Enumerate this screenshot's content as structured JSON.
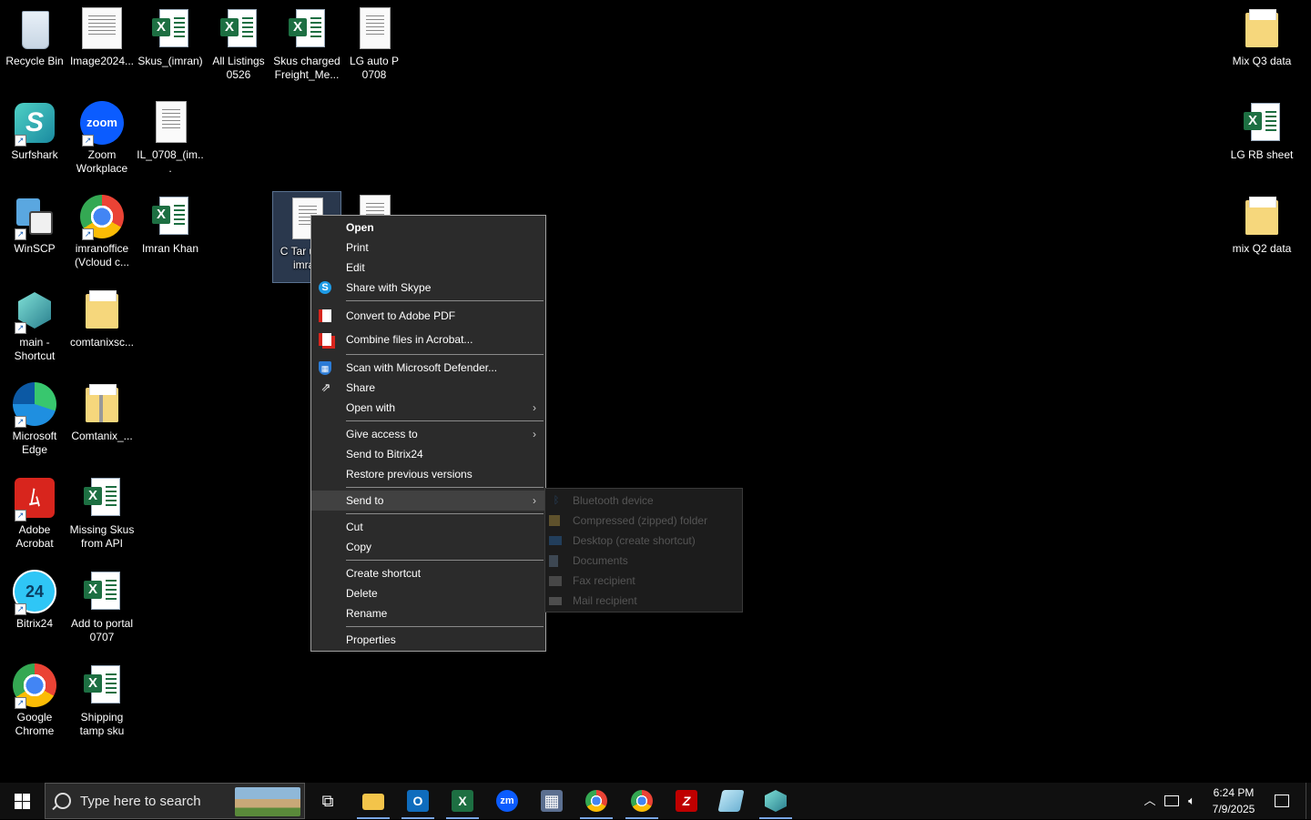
{
  "desktop": {
    "left_icons": [
      {
        "label": "Recycle Bin",
        "icon": "recycle-bin-icon"
      },
      {
        "label": "Image2024...",
        "icon": "image-document-icon"
      },
      {
        "label": "Skus_(imran)",
        "icon": "excel-file-icon"
      },
      {
        "label": "All Listings 0526",
        "icon": "excel-file-icon"
      },
      {
        "label": "Skus charged Freight_Me...",
        "icon": "excel-file-icon"
      },
      {
        "label": "LG auto P 0708",
        "icon": "text-file-icon"
      },
      {
        "label": "Surfshark",
        "icon": "surfshark-icon"
      },
      {
        "label": "Zoom Workplace",
        "icon": "zoom-icon"
      },
      {
        "label": "IL_0708_(im...",
        "icon": "text-file-icon"
      },
      {
        "label": "WinSCP",
        "icon": "winscp-icon"
      },
      {
        "label": "imranoffice (Vcloud c...",
        "icon": "chrome-profile-icon"
      },
      {
        "label": "Imran Khan",
        "icon": "excel-file-icon"
      },
      {
        "label": "C Tar upda imran",
        "icon": "text-file-icon"
      },
      {
        "label": "main - Shortcut",
        "icon": "app-shortcut-icon"
      },
      {
        "label": "comtanixsc...",
        "icon": "folder-icon"
      },
      {
        "label": "Microsoft Edge",
        "icon": "edge-icon"
      },
      {
        "label": "Comtanix_...",
        "icon": "zip-folder-icon"
      },
      {
        "label": "Adobe Acrobat",
        "icon": "acrobat-icon"
      },
      {
        "label": "Missing Skus from API",
        "icon": "excel-file-icon"
      },
      {
        "label": "Bitrix24",
        "icon": "bitrix24-icon"
      },
      {
        "label": "Add to portal 0707",
        "icon": "excel-file-icon"
      },
      {
        "label": "Google Chrome",
        "icon": "chrome-icon"
      },
      {
        "label": "Shipping tamp sku",
        "icon": "excel-file-icon"
      }
    ],
    "right_icons": [
      {
        "label": "Mix Q3 data",
        "icon": "folder-icon"
      },
      {
        "label": "LG RB sheet",
        "icon": "excel-file-icon"
      },
      {
        "label": "mix Q2 data",
        "icon": "folder-icon"
      }
    ]
  },
  "context_menu": {
    "items": [
      {
        "label": "Open"
      },
      {
        "label": "Print"
      },
      {
        "label": "Edit"
      },
      {
        "label": "Share with Skype",
        "icon": "skype-icon"
      },
      {
        "label": "Convert to Adobe PDF",
        "icon": "acrobat-convert-icon"
      },
      {
        "label": "Combine files in Acrobat...",
        "icon": "acrobat-combine-icon"
      },
      {
        "label": "Scan with Microsoft Defender...",
        "icon": "defender-shield-icon"
      },
      {
        "label": "Share",
        "icon": "share-icon"
      },
      {
        "label": "Open with"
      },
      {
        "label": "Give access to"
      },
      {
        "label": "Send to Bitrix24"
      },
      {
        "label": "Restore previous versions"
      },
      {
        "label": "Send to"
      },
      {
        "label": "Cut"
      },
      {
        "label": "Copy"
      },
      {
        "label": "Create shortcut"
      },
      {
        "label": "Delete"
      },
      {
        "label": "Rename"
      },
      {
        "label": "Properties"
      }
    ],
    "submenu_arrow": "›"
  },
  "send_to_submenu": {
    "items": [
      {
        "label": "Bluetooth device",
        "icon": "bluetooth-icon"
      },
      {
        "label": "Compressed (zipped) folder",
        "icon": "zip-folder-icon"
      },
      {
        "label": "Desktop (create shortcut)",
        "icon": "desktop-icon"
      },
      {
        "label": "Documents",
        "icon": "documents-icon"
      },
      {
        "label": "Fax recipient",
        "icon": "fax-icon"
      },
      {
        "label": "Mail recipient",
        "icon": "mail-icon"
      }
    ]
  },
  "taskbar": {
    "search_placeholder": "Type here to search",
    "apps": [
      {
        "name": "task-view",
        "glyph": "⧉"
      },
      {
        "name": "file-explorer",
        "glyph": "▬"
      },
      {
        "name": "outlook",
        "glyph": "O"
      },
      {
        "name": "excel",
        "glyph": "X"
      },
      {
        "name": "zoom",
        "glyph": "zm"
      },
      {
        "name": "calculator",
        "glyph": "▦"
      },
      {
        "name": "chrome",
        "glyph": "◉"
      },
      {
        "name": "chrome-profile",
        "glyph": "◉"
      },
      {
        "name": "filezilla",
        "glyph": "Z"
      },
      {
        "name": "notepad",
        "glyph": "▱"
      },
      {
        "name": "main-app",
        "glyph": "◆"
      }
    ],
    "clock": {
      "time": "6:24 PM",
      "date": "7/9/2025"
    },
    "colors": {
      "excel_green": "#1d6f42",
      "outlook_blue": "#0f6cbd",
      "zoom_blue": "#0b5cff",
      "filezilla_red": "#bf0000"
    }
  }
}
